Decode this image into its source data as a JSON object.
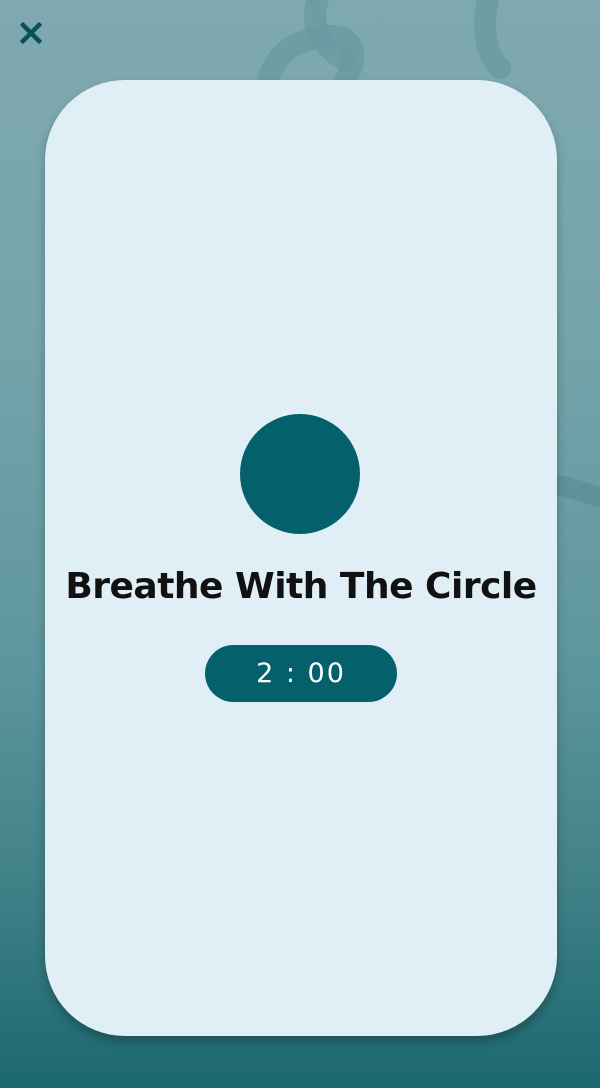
{
  "colors": {
    "accent": "#04616c",
    "card_background": "#e0eff5",
    "title_text": "#111111",
    "close_icon": "#08505a"
  },
  "close_button": {
    "icon": "close-icon"
  },
  "breathing_circle": {
    "icon": "breathing-circle"
  },
  "main": {
    "title": "Breathe With The Circle",
    "timer": "2 : 00"
  }
}
